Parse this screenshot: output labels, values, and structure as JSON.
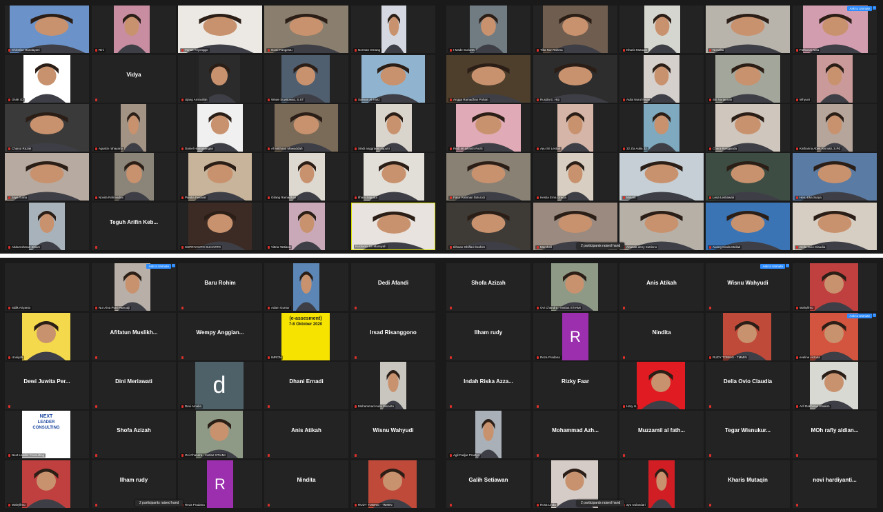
{
  "quadrants": {
    "q1": {
      "tiles": [
        {
          "id": "q1-c1r1",
          "label": "Christine Handayani",
          "photo": "#6b93c9",
          "muted": true
        },
        {
          "id": "q1-c2r1",
          "label": "Rini",
          "photo": "#c88da0",
          "muted": true
        },
        {
          "id": "q1-c3r1",
          "label": "Yunus Triyonggo",
          "photo": "#ece9e4",
          "muted": true
        },
        {
          "id": "q1-c4r1",
          "label": "Gusti Pangestu",
          "photo": "#8a7f6e",
          "muted": true
        },
        {
          "id": "q1-c5r1",
          "label": "Norman Omang",
          "photo": "#d5d8e0",
          "muted": true
        },
        {
          "id": "q1-c1r2",
          "label": "GNIK ID",
          "photo": "#ffffff",
          "muted": true
        },
        {
          "id": "q1-c2r2",
          "name": "Vidya"
        },
        {
          "id": "q1-c3r2",
          "label": "Ujang Aminullah",
          "photo": "#2b2b2b",
          "muted": true
        },
        {
          "id": "q1-c4r2",
          "label": "Wiwie Suwitowati, S.ST",
          "photo": "#4f5f6f",
          "muted": true
        },
        {
          "id": "q1-c5r2",
          "label": "Salman Al Fariz",
          "photo": "#90b4cf",
          "muted": true
        },
        {
          "id": "q1-c1r3",
          "label": "Chairul Razak",
          "photo": "#3a3a3a",
          "muted": true
        },
        {
          "id": "q1-c2r3",
          "label": "Agustin rahayanti",
          "photo": "#a39384",
          "muted": true
        },
        {
          "id": "q1-c3r3",
          "label": "Daniel Hamonangan",
          "photo": "#f0f0f0",
          "muted": true
        },
        {
          "id": "q1-c4r3",
          "label": "Al Mitthatul Mawaddah",
          "photo": "#7a6a58",
          "muted": true
        },
        {
          "id": "q1-c5r3",
          "label": "Sindi anggraeni saputri",
          "photo": "#d9d4cc",
          "muted": true
        },
        {
          "id": "q1-c1r4",
          "label": "Jaye Tuma",
          "photo": "#b7aaa0",
          "muted": true
        },
        {
          "id": "q1-c2r4",
          "label": "Novita Rahmadini",
          "photo": "#8b8478",
          "muted": true
        },
        {
          "id": "q1-c3r4",
          "label": "Panitia Festival",
          "photo": "#c7b49a",
          "muted": true
        },
        {
          "id": "q1-c4r4",
          "label": "Gilang Ramadhan",
          "photo": "#ddd8d0",
          "muted": true
        },
        {
          "id": "q1-c5r4",
          "label": "Ilham Saputra",
          "photo": "#e2dfd8",
          "muted": true
        },
        {
          "id": "q1-c1r5",
          "label": "Abdurrohman Shiam",
          "photo": "#a8b2bb",
          "muted": true
        },
        {
          "id": "q1-c2r5",
          "name": "Teguh Arifin Keb..."
        },
        {
          "id": "q1-c3r5",
          "label": "SUPRIYANTO SUHARTO",
          "photo": "#3b2b24",
          "muted": true
        },
        {
          "id": "q1-c4r5",
          "label": "Vittria Tattiana",
          "photo": "#c9a9b8",
          "muted": true
        },
        {
          "id": "q1-c5r5",
          "label": "Kustiarini Sri Marsiyah",
          "photo": "#e8e3de",
          "muted": false,
          "speaker": true
        }
      ]
    },
    "q2": {
      "tiles": [
        {
          "id": "q2-c1r1",
          "label": "I Made Suriarta",
          "photo": "#707b82",
          "muted": true
        },
        {
          "id": "q2-c2r1",
          "label": "Tika Nur Rahma",
          "photo": "#6f5d4f",
          "muted": true
        },
        {
          "id": "q2-c3r1",
          "label": "Kharis Mutaqin",
          "photo": "#d5d6cf",
          "muted": true
        },
        {
          "id": "q2-c4r1",
          "label": "Novalita",
          "photo": "#b8b3ab",
          "muted": true
        },
        {
          "id": "q2-c5r1",
          "label": "Fathurun Nisa",
          "photo": "#d39db0",
          "muted": true,
          "unmute": "Ask to Unmute"
        },
        {
          "id": "q2-c1r2",
          "label": "Angga Ramadhan Pohan",
          "photo": "#4e3f2c",
          "muted": true
        },
        {
          "id": "q2-c2r2",
          "label": "Rusdin E. Hrp",
          "photo": "#2d2d2d",
          "muted": true
        },
        {
          "id": "q2-c3r2",
          "label": "Aulia Nurul Ihsan",
          "photo": "#d6d0cc",
          "muted": true
        },
        {
          "id": "q2-c4r2",
          "label": "Siti Nurjannah",
          "photo": "#a3a69a",
          "muted": true
        },
        {
          "id": "q2-c5r2",
          "label": "Whyuni",
          "photo": "#c99a99",
          "muted": true
        },
        {
          "id": "q2-c1r3",
          "label": "Redt sri juliantri Rezti",
          "photo": "#e0aab6",
          "muted": true
        },
        {
          "id": "q2-c2r3",
          "label": "Ayu Sri Lestari",
          "photo": "#d4b5a8",
          "muted": true
        },
        {
          "id": "q2-c3r3",
          "label": "32 Zia Aulia 32",
          "photo": "#7fa9bf",
          "muted": true
        },
        {
          "id": "q2-c4r3",
          "label": "Chera Rosiganda",
          "photo": "#cfc6bd",
          "muted": true
        },
        {
          "id": "q2-c5r3",
          "label": "Katharina Abek Rismati, S.Pd",
          "photo": "#b5a59b",
          "muted": true
        },
        {
          "id": "q2-c1r4",
          "label": "Fatur Rahman fahurozi",
          "photo": "#8a8175",
          "muted": true
        },
        {
          "id": "q2-c2r4",
          "label": "Hestia Erna Grecia",
          "photo": "#d8cfc2",
          "muted": true
        },
        {
          "id": "q2-c3r4",
          "label": "Minarti",
          "photo": "#c5cfd5",
          "muted": true
        },
        {
          "id": "q2-c4r4",
          "label": "Lesa Lestiawati",
          "photo": "#3d4d43",
          "muted": true
        },
        {
          "id": "q2-c5r4",
          "label": "Heru Eka Surya",
          "photo": "#5a7ba3",
          "muted": true
        },
        {
          "id": "q2-c1r5",
          "label": "Ikhwan Ghiffari Ibrahim",
          "photo": "#3e3b36",
          "muted": true
        },
        {
          "id": "q2-c2r5",
          "label": "Merchell",
          "photo": "#9a8a80",
          "muted": true
        },
        {
          "id": "q2-c3r5",
          "label": "Ananda deny Sutrisno",
          "photo": "#b7b0a7",
          "muted": true
        },
        {
          "id": "q2-c4r5",
          "label": "Auong Dinda Meilati",
          "photo": "#3b74b4",
          "muted": true
        },
        {
          "id": "q2-c5r5",
          "label": "Della Ovio Claudia",
          "photo": "#d6cec2",
          "muted": true
        }
      ],
      "raised_hand": "2 participants raised hand"
    },
    "q3": {
      "tiles": [
        {
          "id": "q3-c1r1",
          "label": "Sidik Ariyanto",
          "muted": true
        },
        {
          "id": "q3-c2r1",
          "label": "Nur Aina Putri Pamudji",
          "photo": "#b8b0a8",
          "muted": true,
          "unmute": "Ask to Unmute"
        },
        {
          "id": "q3-c3r1",
          "name": "Baru Rohim"
        },
        {
          "id": "q3-c4r1",
          "label": "Adam Guntur",
          "photo": "#5b86b5",
          "muted": true
        },
        {
          "id": "q3-c5r1",
          "name": "Dedi Afandi"
        },
        {
          "id": "q3-c1r2",
          "label": "Unsiyah",
          "photo": "#f4d94c",
          "muted": true
        },
        {
          "id": "q3-c2r2",
          "name": "Afifatun Muslikh..."
        },
        {
          "id": "q3-c3r2",
          "name": "Wempy Anggian..."
        },
        {
          "id": "q3-c4r2",
          "label": "IMRON",
          "photo": "#f6e400",
          "muted": true,
          "poster": [
            "(e-assesment)",
            "7-8 Oktober 2020"
          ]
        },
        {
          "id": "q3-c5r2",
          "name": "Irsad Risanggono"
        },
        {
          "id": "q3-c1r3",
          "name": "Dewi Juwita Per..."
        },
        {
          "id": "q3-c2r3",
          "name": "Dini Meriawati"
        },
        {
          "id": "q3-c3r3",
          "label": "Devi Amalia",
          "muted": true,
          "avatar": "d",
          "avatarColor": "#4f6168"
        },
        {
          "id": "q3-c4r3",
          "name": "Dhani Ernadi"
        },
        {
          "id": "q3-c5r3",
          "label": "Mohammad Aulia Sisianto",
          "photo": "#c9c6bf",
          "muted": true
        },
        {
          "id": "q3-c1r4",
          "label": "Next Leader Consulting",
          "photo": "#ffffff",
          "muted": true,
          "poster": [
            "NEXT",
            "LEADER",
            "CONSULTING"
          ]
        },
        {
          "id": "q3-c2r4",
          "name": "Shofa Azizah"
        },
        {
          "id": "q3-c3r4",
          "label": "Ovi Chandra - Institut STIAMI",
          "photo": "#8f9a86",
          "muted": true
        },
        {
          "id": "q3-c4r4",
          "name": "Anis Atikah"
        },
        {
          "id": "q3-c5r4",
          "name": "Wisnu Wahyudi"
        },
        {
          "id": "q3-c1r5",
          "label": "Wahyllmo",
          "photo": "#c04040",
          "muted": true
        },
        {
          "id": "q3-c2r5",
          "name": "Ilham rudy"
        },
        {
          "id": "q3-c3r5",
          "label": "Reza Pradana",
          "muted": true,
          "avatar": "R",
          "avatarColor": "#9b2fae"
        },
        {
          "id": "q3-c4r5",
          "name": "Nindita"
        },
        {
          "id": "q3-c5r5",
          "label": "RUDY TOBING - TMMIN",
          "photo": "#c04a3a",
          "muted": true
        }
      ],
      "raised_hand": "2 participants raised hand"
    },
    "q4": {
      "tiles": [
        {
          "id": "q4-c1r1",
          "name": "Shofa Azizah"
        },
        {
          "id": "q4-c2r1",
          "label": "Ovi Chandra - Institut STIAMI",
          "photo": "#8f9a86",
          "muted": true
        },
        {
          "id": "q4-c3r1",
          "name": "Anis Atikah"
        },
        {
          "id": "q4-c4r1",
          "name": "Wisnu Wahyudi",
          "unmute": "Ask to Unmute"
        },
        {
          "id": "q4-c5r1",
          "label": "Wahyllmo",
          "photo": "#c04040",
          "muted": true
        },
        {
          "id": "q4-c1r2",
          "name": "Ilham rudy"
        },
        {
          "id": "q4-c2r2",
          "label": "Reza Pradana",
          "muted": true,
          "avatar": "R",
          "avatarColor": "#9b2fae"
        },
        {
          "id": "q4-c3r2",
          "name": "Nindita"
        },
        {
          "id": "q4-c4r2",
          "label": "RUDY TOBING - TMMIN",
          "photo": "#c04a3a",
          "muted": true
        },
        {
          "id": "q4-c5r2",
          "label": "eveline victoria",
          "photo": "#d4553f",
          "muted": true,
          "unmute": "Ask to Unmute"
        },
        {
          "id": "q4-c1r3",
          "name": "Indah Riska Azza..."
        },
        {
          "id": "q4-c2r3",
          "name": "Rizky Faar"
        },
        {
          "id": "q4-c3r3",
          "label": "Hary H.",
          "photo": "#e01b22",
          "muted": true
        },
        {
          "id": "q4-c4r3",
          "name": "Della Ovio Claudia"
        },
        {
          "id": "q4-c5r3",
          "label": "Arif Rakhman Khakim",
          "photo": "#d9d9d4",
          "muted": true
        },
        {
          "id": "q4-c1r4",
          "label": "Agil Fadjar Prastyo",
          "photo": "#a9b0b7",
          "muted": true
        },
        {
          "id": "q4-c2r4",
          "name": "Mohammad Azh..."
        },
        {
          "id": "q4-c3r4",
          "name": "Muzzamil al fath..."
        },
        {
          "id": "q4-c4r4",
          "name": "Tegar Wisnukur..."
        },
        {
          "id": "q4-c5r4",
          "name": "MOh rafly aldian..."
        },
        {
          "id": "q4-c1r5",
          "name": "Galih Setiawan"
        },
        {
          "id": "q4-c2r5",
          "label": "Rosa Linda",
          "photo": "#d5ccc7",
          "muted": true
        },
        {
          "id": "q4-c3r5",
          "label": "ayu wulandari",
          "photo": "#d01e24",
          "muted": true
        },
        {
          "id": "q4-c4r5",
          "name": "Kharis Mutaqin"
        },
        {
          "id": "q4-c5r5",
          "name": "novi hardiyanti..."
        }
      ],
      "raised_hand": "2 participants raised hand"
    }
  }
}
